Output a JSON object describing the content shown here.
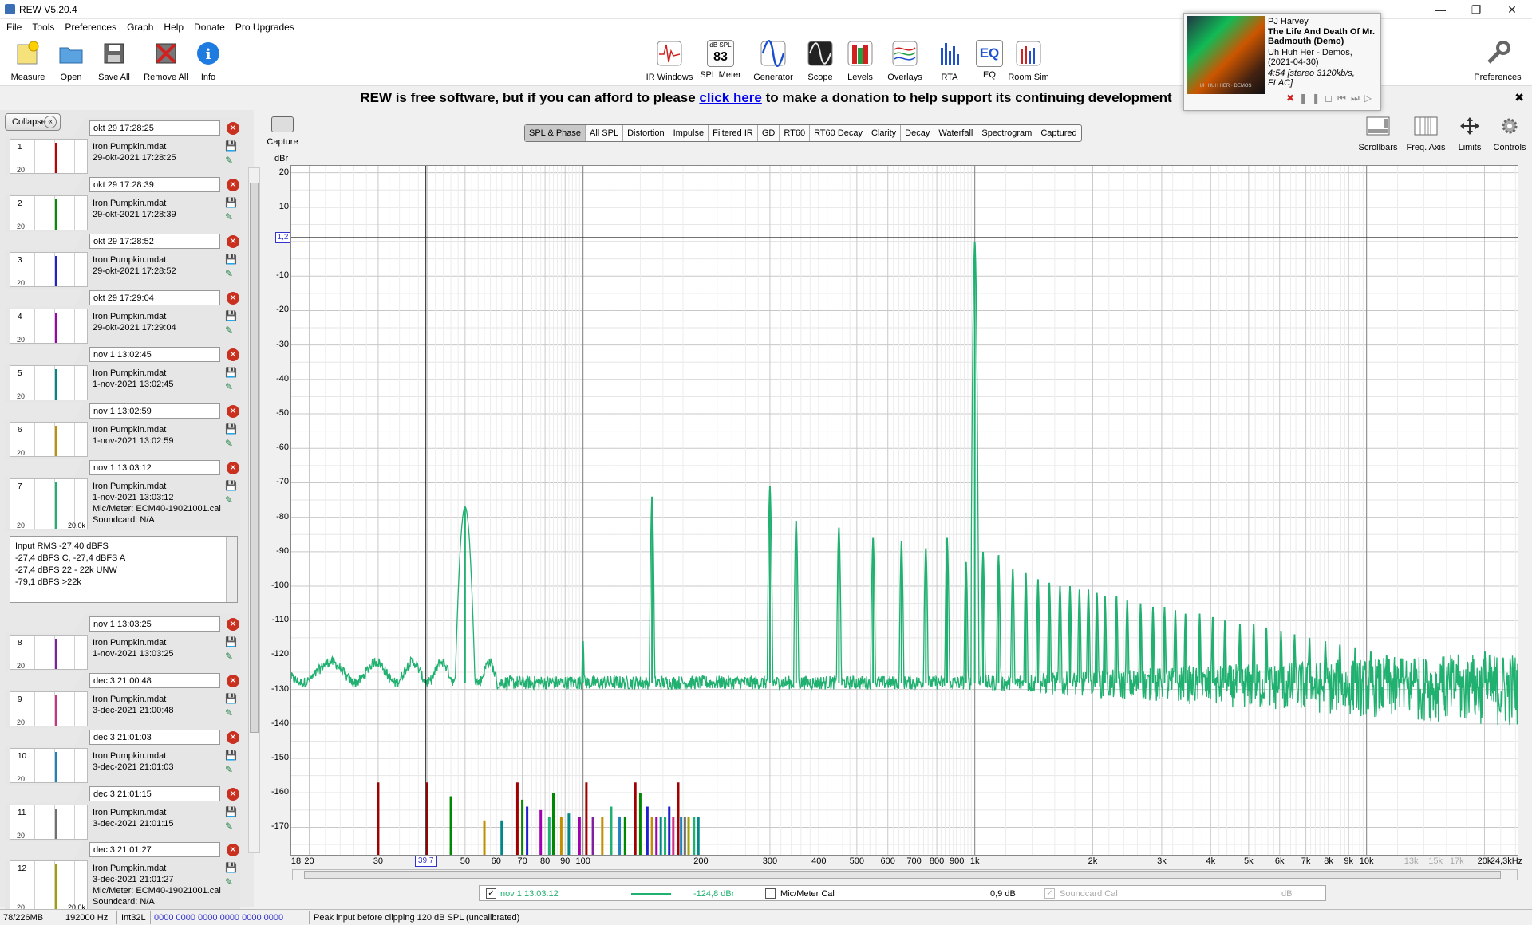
{
  "app": {
    "title": "REW V5.20.4"
  },
  "menu": [
    "File",
    "Tools",
    "Preferences",
    "Graph",
    "Help",
    "Donate",
    "Pro Upgrades"
  ],
  "toolbar": {
    "left": [
      "Measure",
      "Open",
      "Save All",
      "Remove All",
      "Info"
    ],
    "center": [
      "IR Windows",
      "SPL Meter",
      "Generator",
      "Scope",
      "Levels",
      "Overlays",
      "RTA",
      "EQ",
      "Room Sim"
    ],
    "spl_value": "83",
    "spl_unit": "dB SPL",
    "eq_label": "EQ",
    "preferences": "Preferences"
  },
  "donate": {
    "prefix": "REW is free software, but if you can afford to please ",
    "link": "click here",
    "suffix": " to make a donation to help support its continuing development",
    "close": "✖"
  },
  "now_playing": {
    "artist": "PJ Harvey",
    "title": "The Life And Death Of Mr. Badmouth (Demo)",
    "album": "Uh Huh Her - Demos, (2021-04-30)",
    "info": "4:54 [stereo 3120kb/s, FLAC]",
    "art_caption": "UH HUH HER · DEMOS"
  },
  "sidebar": {
    "collapse": "Collapse",
    "twenty": "20",
    "thumb_right": "20,0k",
    "measurements": [
      {
        "name": "okt 29 17:28:25",
        "num": "1",
        "file": "Iron Pumpkin.mdat",
        "date": "29-okt-2021 17:28:25",
        "color": "#c00000"
      },
      {
        "name": "okt 29 17:28:39",
        "num": "2",
        "file": "Iron Pumpkin.mdat",
        "date": "29-okt-2021 17:28:39",
        "color": "#009000"
      },
      {
        "name": "okt 29 17:28:52",
        "num": "3",
        "file": "Iron Pumpkin.mdat",
        "date": "29-okt-2021 17:28:52",
        "color": "#2020d0"
      },
      {
        "name": "okt 29 17:29:04",
        "num": "4",
        "file": "Iron Pumpkin.mdat",
        "date": "29-okt-2021 17:29:04",
        "color": "#a000b0"
      },
      {
        "name": "nov 1 13:02:45",
        "num": "5",
        "file": "Iron Pumpkin.mdat",
        "date": "1-nov-2021 13:02:45",
        "color": "#008888"
      },
      {
        "name": "nov 1 13:02:59",
        "num": "6",
        "file": "Iron Pumpkin.mdat",
        "date": "1-nov-2021 13:02:59",
        "color": "#c09000"
      },
      {
        "name": "nov 1 13:03:12",
        "num": "7",
        "file": "Iron Pumpkin.mdat",
        "date": "1-nov-2021 13:03:12",
        "mic": "Mic/Meter: ECM40-19021001.cal",
        "soundcard": "Soundcard: N/A",
        "color": "#20b070"
      },
      {
        "name": "nov 1 13:03:25",
        "num": "8",
        "file": "Iron Pumpkin.mdat",
        "date": "1-nov-2021 13:03:25",
        "color": "#8020a0"
      },
      {
        "name": "dec 3 21:00:48",
        "num": "9",
        "file": "Iron Pumpkin.mdat",
        "date": "3-dec-2021 21:00:48",
        "color": "#d03080"
      },
      {
        "name": "dec 3 21:01:03",
        "num": "10",
        "file": "Iron Pumpkin.mdat",
        "date": "3-dec-2021 21:01:03",
        "color": "#2080c0"
      },
      {
        "name": "dec 3 21:01:15",
        "num": "11",
        "file": "Iron Pumpkin.mdat",
        "date": "3-dec-2021 21:01:15",
        "color": "#707070"
      },
      {
        "name": "dec 3 21:01:27",
        "num": "12",
        "file": "Iron Pumpkin.mdat",
        "date": "3-dec-2021 21:01:27",
        "mic": "Mic/Meter: ECM40-19021001.cal",
        "soundcard": "Soundcard: N/A",
        "color": "#a0a000"
      }
    ],
    "stats": [
      "Input RMS -27,40 dBFS",
      "-27,4 dBFS C, -27,4 dBFS A",
      "-27,4 dBFS 22 - 22k UNW",
      "-79,1 dBFS >22k"
    ]
  },
  "capture": "Capture",
  "graph_tabs": [
    "SPL & Phase",
    "All SPL",
    "Distortion",
    "Impulse",
    "Filtered IR",
    "GD",
    "RT60",
    "RT60 Decay",
    "Clarity",
    "Decay",
    "Waterfall",
    "Spectrogram",
    "Captured"
  ],
  "right_tools": [
    "Scrollbars",
    "Freq. Axis",
    "Limits",
    "Controls"
  ],
  "cursor": {
    "y_value": "1,2",
    "x_value": "39,7"
  },
  "legend": {
    "meas_name": "nov 1 13:03:12",
    "meas_value": "-124,8 dBr",
    "mic_label": "Mic/Meter Cal",
    "mic_value": "0,9 dB",
    "sc_label": "Soundcard Cal",
    "sc_value": "dB",
    "check": "✓"
  },
  "status": {
    "memory": "78/226MB",
    "rate": "192000 Hz",
    "format": "Int32L",
    "bits": "0000 0000  0000 0000  0000 0000",
    "message": "Peak input before clipping 120 dB SPL (uncalibrated)"
  },
  "chart_data": {
    "type": "line",
    "ylabel": "dBr",
    "ylim": [
      -178,
      22
    ],
    "xlim": [
      18,
      24300
    ],
    "x_scale": "log",
    "y_ticks": [
      20,
      10,
      -10,
      -20,
      -30,
      -40,
      -50,
      -60,
      -70,
      -80,
      -90,
      -100,
      -110,
      -120,
      -130,
      -140,
      -150,
      -160,
      -170
    ],
    "x_ticks": [
      {
        "v": 18,
        "l": "18"
      },
      {
        "v": 20,
        "l": "20"
      },
      {
        "v": 30,
        "l": "30"
      },
      {
        "v": 50,
        "l": "50"
      },
      {
        "v": 60,
        "l": "60"
      },
      {
        "v": 70,
        "l": "70"
      },
      {
        "v": 80,
        "l": "80"
      },
      {
        "v": 90,
        "l": "90"
      },
      {
        "v": 100,
        "l": "100"
      },
      {
        "v": 200,
        "l": "200"
      },
      {
        "v": 300,
        "l": "300"
      },
      {
        "v": 400,
        "l": "400"
      },
      {
        "v": 500,
        "l": "500"
      },
      {
        "v": 600,
        "l": "600"
      },
      {
        "v": 700,
        "l": "700"
      },
      {
        "v": 800,
        "l": "800"
      },
      {
        "v": 900,
        "l": "900"
      },
      {
        "v": 1000,
        "l": "1k"
      },
      {
        "v": 2000,
        "l": "2k"
      },
      {
        "v": 3000,
        "l": "3k"
      },
      {
        "v": 4000,
        "l": "4k"
      },
      {
        "v": 5000,
        "l": "5k"
      },
      {
        "v": 6000,
        "l": "6k"
      },
      {
        "v": 7000,
        "l": "7k"
      },
      {
        "v": 8000,
        "l": "8k"
      },
      {
        "v": 9000,
        "l": "9k"
      },
      {
        "v": 10000,
        "l": "10k"
      },
      {
        "v": 13000,
        "l": "13k",
        "dim": true
      },
      {
        "v": 15000,
        "l": "15k",
        "dim": true
      },
      {
        "v": 17000,
        "l": "17k",
        "dim": true
      },
      {
        "v": 20000,
        "l": "20k"
      },
      {
        "v": 24300,
        "l": "24,3kHz"
      }
    ],
    "series": [
      {
        "name": "nov 1 13:03:12",
        "color": "#20b070",
        "noise_floor": -128,
        "peaks": [
          {
            "f": 50,
            "db": -77
          },
          {
            "f": 100,
            "db": -116
          },
          {
            "f": 150,
            "db": -74
          },
          {
            "f": 300,
            "db": -71
          },
          {
            "f": 350,
            "db": -81
          },
          {
            "f": 450,
            "db": -83
          },
          {
            "f": 550,
            "db": -86
          },
          {
            "f": 650,
            "db": -87
          },
          {
            "f": 750,
            "db": -89
          },
          {
            "f": 850,
            "db": -86
          },
          {
            "f": 950,
            "db": -93
          },
          {
            "f": 1000,
            "db": 0
          },
          {
            "f": 1050,
            "db": -90
          },
          {
            "f": 1150,
            "db": -91
          },
          {
            "f": 1250,
            "db": -95
          },
          {
            "f": 1350,
            "db": -96
          },
          {
            "f": 1450,
            "db": -98
          },
          {
            "f": 1550,
            "db": -99
          },
          {
            "f": 1650,
            "db": -100
          },
          {
            "f": 1750,
            "db": -100
          },
          {
            "f": 1850,
            "db": -101
          },
          {
            "f": 1950,
            "db": -101
          },
          {
            "f": 2050,
            "db": -102
          },
          {
            "f": 2150,
            "db": -103
          },
          {
            "f": 2300,
            "db": -103
          },
          {
            "f": 2450,
            "db": -104
          },
          {
            "f": 2650,
            "db": -105
          },
          {
            "f": 2850,
            "db": -106
          },
          {
            "f": 3050,
            "db": -106
          },
          {
            "f": 3250,
            "db": -107
          },
          {
            "f": 3450,
            "db": -108
          },
          {
            "f": 3750,
            "db": -108
          },
          {
            "f": 4050,
            "db": -109
          },
          {
            "f": 4350,
            "db": -110
          },
          {
            "f": 4750,
            "db": -111
          },
          {
            "f": 5150,
            "db": -111
          },
          {
            "f": 5550,
            "db": -112
          },
          {
            "f": 6050,
            "db": -113
          },
          {
            "f": 6550,
            "db": -114
          },
          {
            "f": 7150,
            "db": -115
          },
          {
            "f": 7850,
            "db": -116
          },
          {
            "f": 8550,
            "db": -117
          },
          {
            "f": 9350,
            "db": -118
          },
          {
            "f": 10250,
            "db": -119
          },
          {
            "f": 11250,
            "db": -120
          },
          {
            "f": 12250,
            "db": -121
          },
          {
            "f": 13250,
            "db": -121
          },
          {
            "f": 14250,
            "db": -122
          },
          {
            "f": 15500,
            "db": -123
          },
          {
            "f": 17000,
            "db": -123
          },
          {
            "f": 18500,
            "db": -122
          },
          {
            "f": 20050,
            "db": -119
          }
        ]
      }
    ],
    "indicator_bars": [
      {
        "f": 30,
        "db": -157,
        "color": "#a00000"
      },
      {
        "f": 40,
        "db": -157,
        "color": "#a00000"
      },
      {
        "f": 46,
        "db": -161,
        "color": "#008800"
      },
      {
        "f": 56,
        "db": -168,
        "color": "#c09000"
      },
      {
        "f": 62,
        "db": -168,
        "color": "#008888"
      },
      {
        "f": 68,
        "db": -157,
        "color": "#a00000"
      },
      {
        "f": 70,
        "db": -162,
        "color": "#008800"
      },
      {
        "f": 72,
        "db": -164,
        "color": "#2020d0"
      },
      {
        "f": 78,
        "db": -165,
        "color": "#a000b0"
      },
      {
        "f": 82,
        "db": -167,
        "color": "#20b070"
      },
      {
        "f": 84,
        "db": -160,
        "color": "#008800"
      },
      {
        "f": 88,
        "db": -167,
        "color": "#c09000"
      },
      {
        "f": 92,
        "db": -166,
        "color": "#008888"
      },
      {
        "f": 98,
        "db": -167,
        "color": "#a000b0"
      },
      {
        "f": 102,
        "db": -157,
        "color": "#a00000"
      },
      {
        "f": 106,
        "db": -167,
        "color": "#8020a0"
      },
      {
        "f": 112,
        "db": -167,
        "color": "#c09000"
      },
      {
        "f": 118,
        "db": -164,
        "color": "#20b070"
      },
      {
        "f": 124,
        "db": -167,
        "color": "#2080c0"
      },
      {
        "f": 128,
        "db": -167,
        "color": "#008800"
      },
      {
        "f": 136,
        "db": -157,
        "color": "#a00000"
      },
      {
        "f": 140,
        "db": -160,
        "color": "#008800"
      },
      {
        "f": 146,
        "db": -164,
        "color": "#2020d0"
      },
      {
        "f": 150,
        "db": -167,
        "color": "#c09000"
      },
      {
        "f": 154,
        "db": -167,
        "color": "#a000b0"
      },
      {
        "f": 158,
        "db": -167,
        "color": "#008888"
      },
      {
        "f": 162,
        "db": -167,
        "color": "#20b070"
      },
      {
        "f": 166,
        "db": -164,
        "color": "#2020d0"
      },
      {
        "f": 170,
        "db": -167,
        "color": "#d03080"
      },
      {
        "f": 175,
        "db": -157,
        "color": "#a00000"
      },
      {
        "f": 178,
        "db": -167,
        "color": "#2080c0"
      },
      {
        "f": 182,
        "db": -167,
        "color": "#707070"
      },
      {
        "f": 186,
        "db": -167,
        "color": "#a0a000"
      },
      {
        "f": 192,
        "db": -167,
        "color": "#20b070"
      },
      {
        "f": 197,
        "db": -167,
        "color": "#008888"
      }
    ]
  }
}
